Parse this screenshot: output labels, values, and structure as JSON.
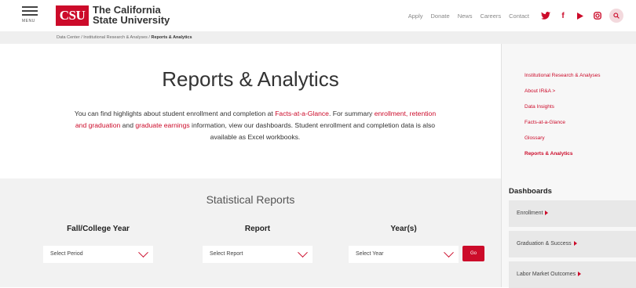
{
  "header": {
    "menu_label": "MENU",
    "logo_abbr": "CSU",
    "logo_line1": "The California",
    "logo_line2": "State University",
    "nav": [
      "Apply",
      "Donate",
      "News",
      "Careers",
      "Contact"
    ],
    "social_icons": [
      "twitter-icon",
      "facebook-icon",
      "youtube-icon",
      "instagram-icon"
    ],
    "search_icon": "search-icon",
    "accent_color": "#cc0b2a"
  },
  "breadcrumb": {
    "items": [
      "Data Center",
      "Institutional Research & Analyses",
      "Reports & Analytics"
    ],
    "separator": "/"
  },
  "main": {
    "title": "Reports & Analytics",
    "intro_part1": "You can find highlights about student enrollment and completion at ",
    "intro_link1": "Facts-at-a-Glance",
    "intro_part2": ". For summary ",
    "intro_link2": "enrollment, retention and graduation",
    "intro_part3": " and ",
    "intro_link3": "graduate earnings",
    "intro_part4": " information, view our dashboards. Student enrollment and completion data is also available as Excel workbooks."
  },
  "stats": {
    "title": "Statistical Reports",
    "col1_label": "Fall/College Year",
    "col1_value": "Select Period",
    "col2_label": "Report",
    "col2_value": "Select Report",
    "col3_label": "Year(s)",
    "col3_value": "Select Year",
    "go_label": "Go"
  },
  "sidebar": {
    "items": [
      "Institutional Research & Analyses",
      "About IR&A  >",
      "Data Insights",
      "Facts-at-a-Glance",
      "Glossary",
      "Reports & Analytics"
    ],
    "active_index": 5,
    "dashboards_title": "Dashboards",
    "dashboards": [
      "Enrollment",
      "Graduation & Success",
      "Labor Market Outcomes"
    ]
  }
}
